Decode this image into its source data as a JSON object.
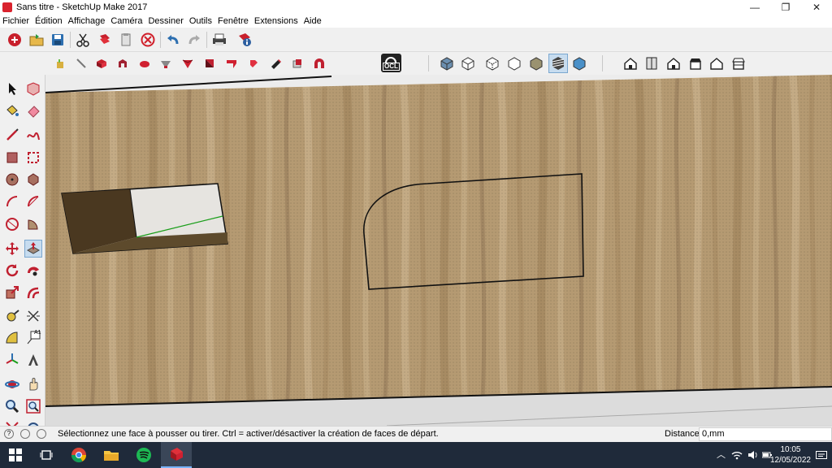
{
  "window": {
    "title": "Sans titre - SketchUp Make 2017",
    "controls": {
      "minimize": "—",
      "restore": "❐",
      "close": "✕"
    }
  },
  "menu": [
    "Fichier",
    "Édition",
    "Affichage",
    "Caméra",
    "Dessiner",
    "Outils",
    "Fenêtre",
    "Extensions",
    "Aide"
  ],
  "toolbar1": {
    "icons": [
      "new-icon",
      "open-icon",
      "save-icon",
      "cut-icon",
      "copy-icon",
      "paste-icon",
      "erase-icon",
      "undo-icon",
      "redo-icon",
      "print-icon",
      "model-info-icon"
    ]
  },
  "toolbar2": {
    "sandbox_icons": [
      "texture-icon",
      "smoove-icon",
      "stamp-icon",
      "drape-icon",
      "add-detail-icon",
      "flip-edge-icon",
      "from-contours-icon",
      "from-scratch-icon",
      "push-pull-face-icon",
      "paint-icon",
      "section-icon",
      "magnet-icon"
    ],
    "ocl_label": "OCL",
    "style_icons": [
      "xray-icon",
      "wireframe-icon",
      "hidden-line-icon",
      "shaded-icon",
      "shaded-texture-icon",
      "monochrome-icon",
      "back-edges-icon"
    ],
    "view_icons": [
      "iso-view-icon",
      "top-view-icon",
      "front-view-icon",
      "right-view-icon",
      "back-view-icon",
      "left-view-icon"
    ]
  },
  "palette": {
    "icons": [
      "select-icon",
      "make-component-icon",
      "paint-bucket-icon",
      "eraser-icon",
      "line-icon",
      "freehand-icon",
      "rectangle-icon",
      "rotated-rectangle-icon",
      "circle-icon",
      "polygon-icon",
      "arc-icon",
      "pie-icon",
      "two-point-arc-icon",
      "three-point-arc-icon",
      "move-icon",
      "push-pull-icon",
      "rotate-icon",
      "follow-me-icon",
      "scale-icon",
      "offset-icon",
      "tape-measure-icon",
      "dimension-icon",
      "protractor-icon",
      "text-icon",
      "axes-icon",
      "3d-text-icon",
      "orbit-icon",
      "pan-icon",
      "zoom-icon",
      "zoom-window-icon"
    ],
    "text_label": "A1"
  },
  "status": {
    "message": "Sélectionnez une face à pousser ou tirer.  Ctrl = activer/désactiver la création de faces de départ.",
    "distance_label": "Distance",
    "distance_value": "0,mm"
  },
  "taskbar": {
    "time": "10:05",
    "date": "12/05/2022"
  },
  "colors": {
    "wood": "#b59a72",
    "accent": "#d9232e",
    "taskbar": "#1f2a3a",
    "green_axis": "#1a9e1a"
  }
}
